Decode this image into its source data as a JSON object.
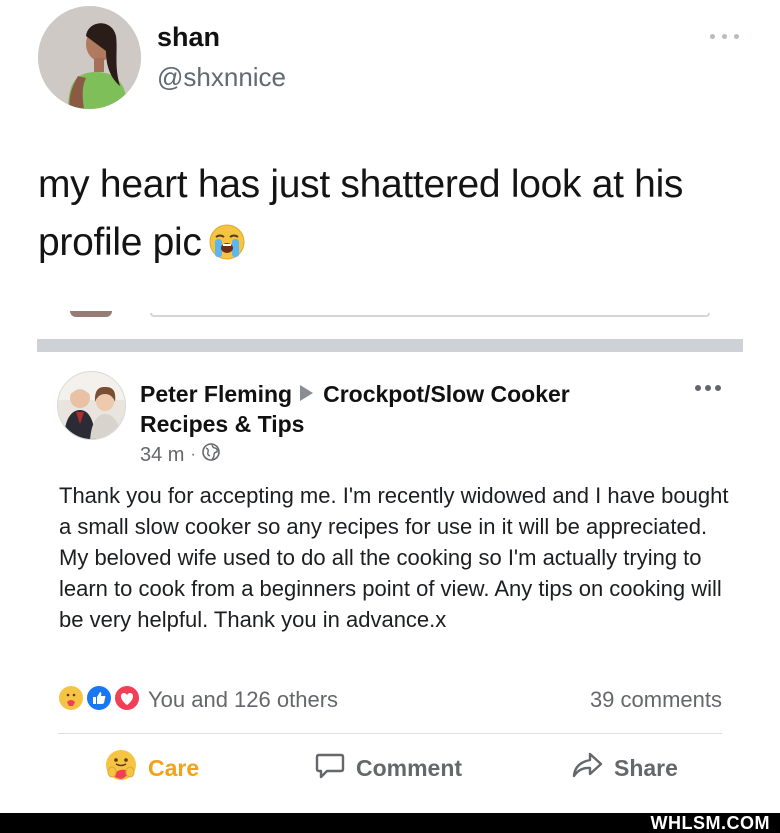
{
  "tweet": {
    "name": "shan",
    "handle": "@shxnnice",
    "text": "my heart has just shattered look at his profile pic",
    "emoji": "loudly-crying-face",
    "avatar_icon": "profile-photo"
  },
  "facebook_post": {
    "author": "Peter Fleming",
    "group": "Crockpot/Slow Cooker Recipes & Tips",
    "time": "34 m",
    "separator": "·",
    "audience_icon": "globe-icon",
    "body": "Thank you for accepting me. I'm recently widowed and I have bought a small slow cooker so any recipes for use in it will be appreciated. My beloved wife used to do all the cooking so I'm actually trying to learn to cook from a beginners point of view.  Any tips on cooking will be very helpful. Thank you in advance.x",
    "reaction_summary": "You and 126 others",
    "comments": "39 comments",
    "reactions": [
      "care-icon",
      "like-icon",
      "love-icon"
    ],
    "actions": {
      "care": "Care",
      "comment": "Comment",
      "share": "Share"
    }
  },
  "colors": {
    "facebook_blue": "#1877f2",
    "love_red": "#f33e58",
    "care_yellow": "#f0a21c",
    "meta_gray": "#65676b"
  },
  "watermark": "WHLSM.COM"
}
